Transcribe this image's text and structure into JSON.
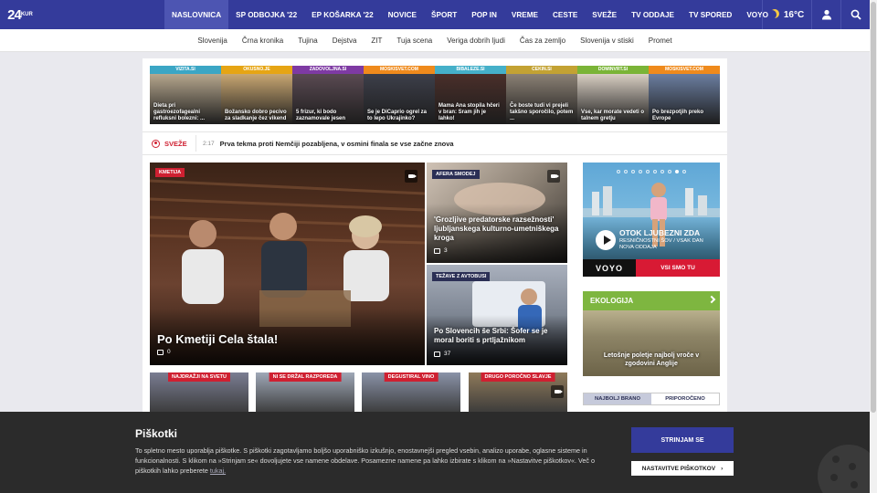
{
  "logo": {
    "main": "24",
    "small": "KUR"
  },
  "nav": {
    "items": [
      "NASLOVNICA",
      "SP ODBOJKA '22",
      "EP KOŠARKA '22",
      "NOVICE",
      "ŠPORT",
      "POP IN",
      "VREME",
      "CESTE",
      "SVEŽE",
      "TV ODDAJE",
      "TV SPORED",
      "VOYO"
    ],
    "temperature": "16°C"
  },
  "subnav": [
    "Slovenija",
    "Črna kronika",
    "Tujina",
    "Dejstva",
    "ZIT",
    "Tuja scena",
    "Veriga dobrih ljudi",
    "Čas za zemljo",
    "Slovenija v stiski",
    "Promet"
  ],
  "partners": [
    {
      "source": "VIZITA.SI",
      "title": "Dieta pri gastroezofagealni refluksni bolezni: ...",
      "color": "#3ba6c5",
      "img": "#b6a78e"
    },
    {
      "source": "OKUSNO.JE",
      "title": "Božansko dobro pecivo za sladkanje čez vikend",
      "color": "#e6a514",
      "img": "#c9a772"
    },
    {
      "source": "ZADOVOLJNA.SI",
      "title": "5 frizur, ki bodo zaznamovale jesen",
      "color": "#7e3aa3",
      "img": "#5a4a52"
    },
    {
      "source": "MOSKISVET.COM",
      "title": "Se je DiCaprio ogrel za to lepo Ukrajinko?",
      "color": "#ef8a1c",
      "img": "#3d3f4a"
    },
    {
      "source": "BIBALEZE.SI",
      "title": "Mama Ana stopila hčeri v bran: Sram jih je lahko!",
      "color": "#45b0c9",
      "img": "#4a2f2a"
    },
    {
      "source": "CEKIN.SI",
      "title": "Če boste tudi vi prejeli takšno sporočilo, potem ...",
      "color": "#c3a233",
      "img": "#8b8175"
    },
    {
      "source": "DOMINVRT.SI",
      "title": "Vse, kar morate vedeti o talnem gretju",
      "color": "#7ab437",
      "img": "#d9cfc3"
    },
    {
      "source": "MOSKISVET.COM",
      "title": "Po brezpotjih preko Evrope",
      "color": "#ef8a1c",
      "img": "#6b7ea0"
    }
  ],
  "sveze": {
    "label": "SVEŽE",
    "time": "2:17",
    "text": "Prva tekma proti Nemčiji pozabljena, v osmini finala se vse začne znova"
  },
  "main_story": {
    "badge": "KMETIJA",
    "title": "Po Kmetiji Cela štala!",
    "comments": "0"
  },
  "story2": {
    "badge": "AFERA SMODEJ",
    "title": "'Grozljive predatorske razsežnosti' ljubljanskega kulturno-umetniškega kroga",
    "comments": "3"
  },
  "story3": {
    "badge": "TEŽAVE Z AVTOBUSI",
    "title": "Po Slovencih še Srbi: Šofer se je moral boriti s prtljažnikom",
    "comments": "37"
  },
  "small_stories": [
    {
      "badge": "NAJDRAŽJI NA SVETU",
      "img": "#7a7d92"
    },
    {
      "badge": "NI SE DRŽAL RAZPOREDA",
      "img": "#9fa8b7"
    },
    {
      "badge": "DEGUSTIRAL VINO",
      "img": "#8a93a8"
    },
    {
      "badge": "DRUGO POROČNO SLAVJE",
      "img": "#8f7a5a"
    }
  ],
  "voyo": {
    "title": "OTOK LJUBEZNI ZDA",
    "subtitle": "RESNIČNOSTNI ŠOV / VSAK DAN NOVA ODDAJA",
    "logo": "VOYO",
    "button": "VSI SMO TU",
    "dots": 10,
    "active_dot": 8
  },
  "ekologija": {
    "head": "EKOLOGIJA",
    "text": "Letošnje poletje najbolj vroče v zgodovini Anglije"
  },
  "tabs": [
    "NAJBOLJ BRANO",
    "PRIPOROČENO"
  ],
  "cookie": {
    "title": "Piškotki",
    "text": "To spletno mesto uporablja piškotke. S piškotki zagotavljamo boljšo uporabniško izkušnjo, enostavnejši pregled vsebin, analizo uporabe, oglasne sisteme in funkcionalnosti. S klikom na »Strinjam se« dovoljujete vse namene obdelave. Posamezne namene pa lahko izbirate s klikom na »Nastavitve piškotkov«. Več o piškotkih lahko preberete",
    "link": "tukaj.",
    "accept": "STRINJAM SE",
    "settings": "NASTAVITVE PIŠKOTKOV",
    "settings_arrow": "›"
  }
}
